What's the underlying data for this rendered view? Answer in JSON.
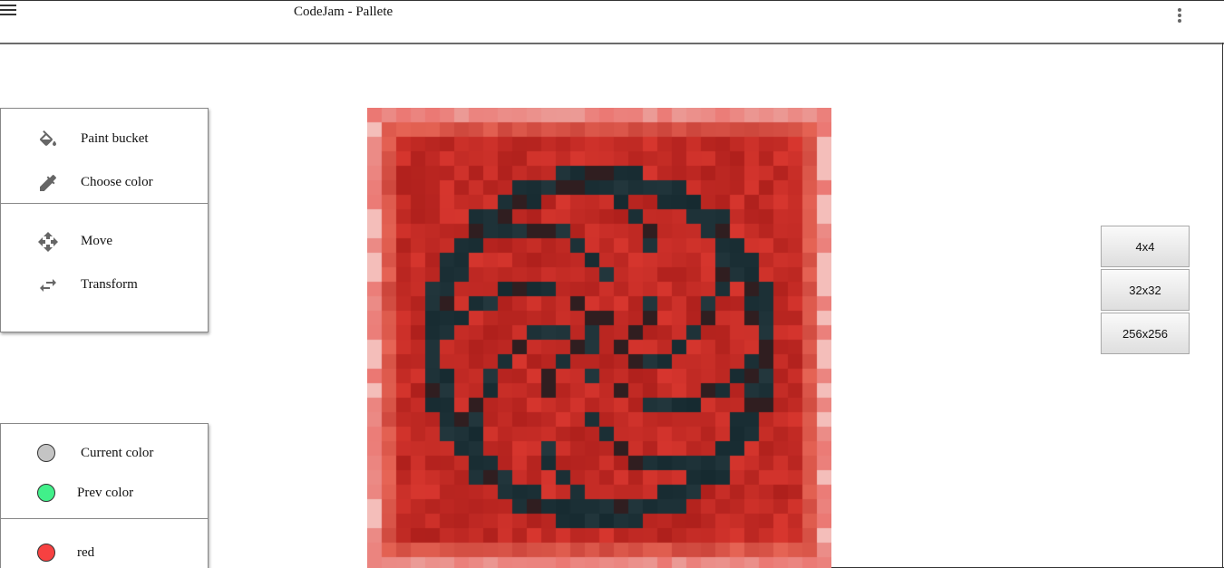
{
  "header": {
    "title": "CodeJam - Pallete"
  },
  "tools": [
    {
      "label": "Paint bucket",
      "icon": "paint-bucket-icon"
    },
    {
      "label": "Choose color",
      "icon": "eyedropper-icon"
    },
    {
      "label": "Move",
      "icon": "move-icon"
    },
    {
      "label": "Transform",
      "icon": "transform-icon"
    }
  ],
  "colors": [
    {
      "label": "Current color",
      "swatch": "#c4c4c4"
    },
    {
      "label": "Prev color",
      "swatch": "#41f08a"
    },
    {
      "label": "red",
      "swatch": "#f74141"
    }
  ],
  "size_buttons": [
    "4x4",
    "32x32",
    "256x256"
  ],
  "theme": {
    "icon_color": "#666666",
    "canvas_red": "#c8322a",
    "canvas_dark": "#1e2a30"
  }
}
